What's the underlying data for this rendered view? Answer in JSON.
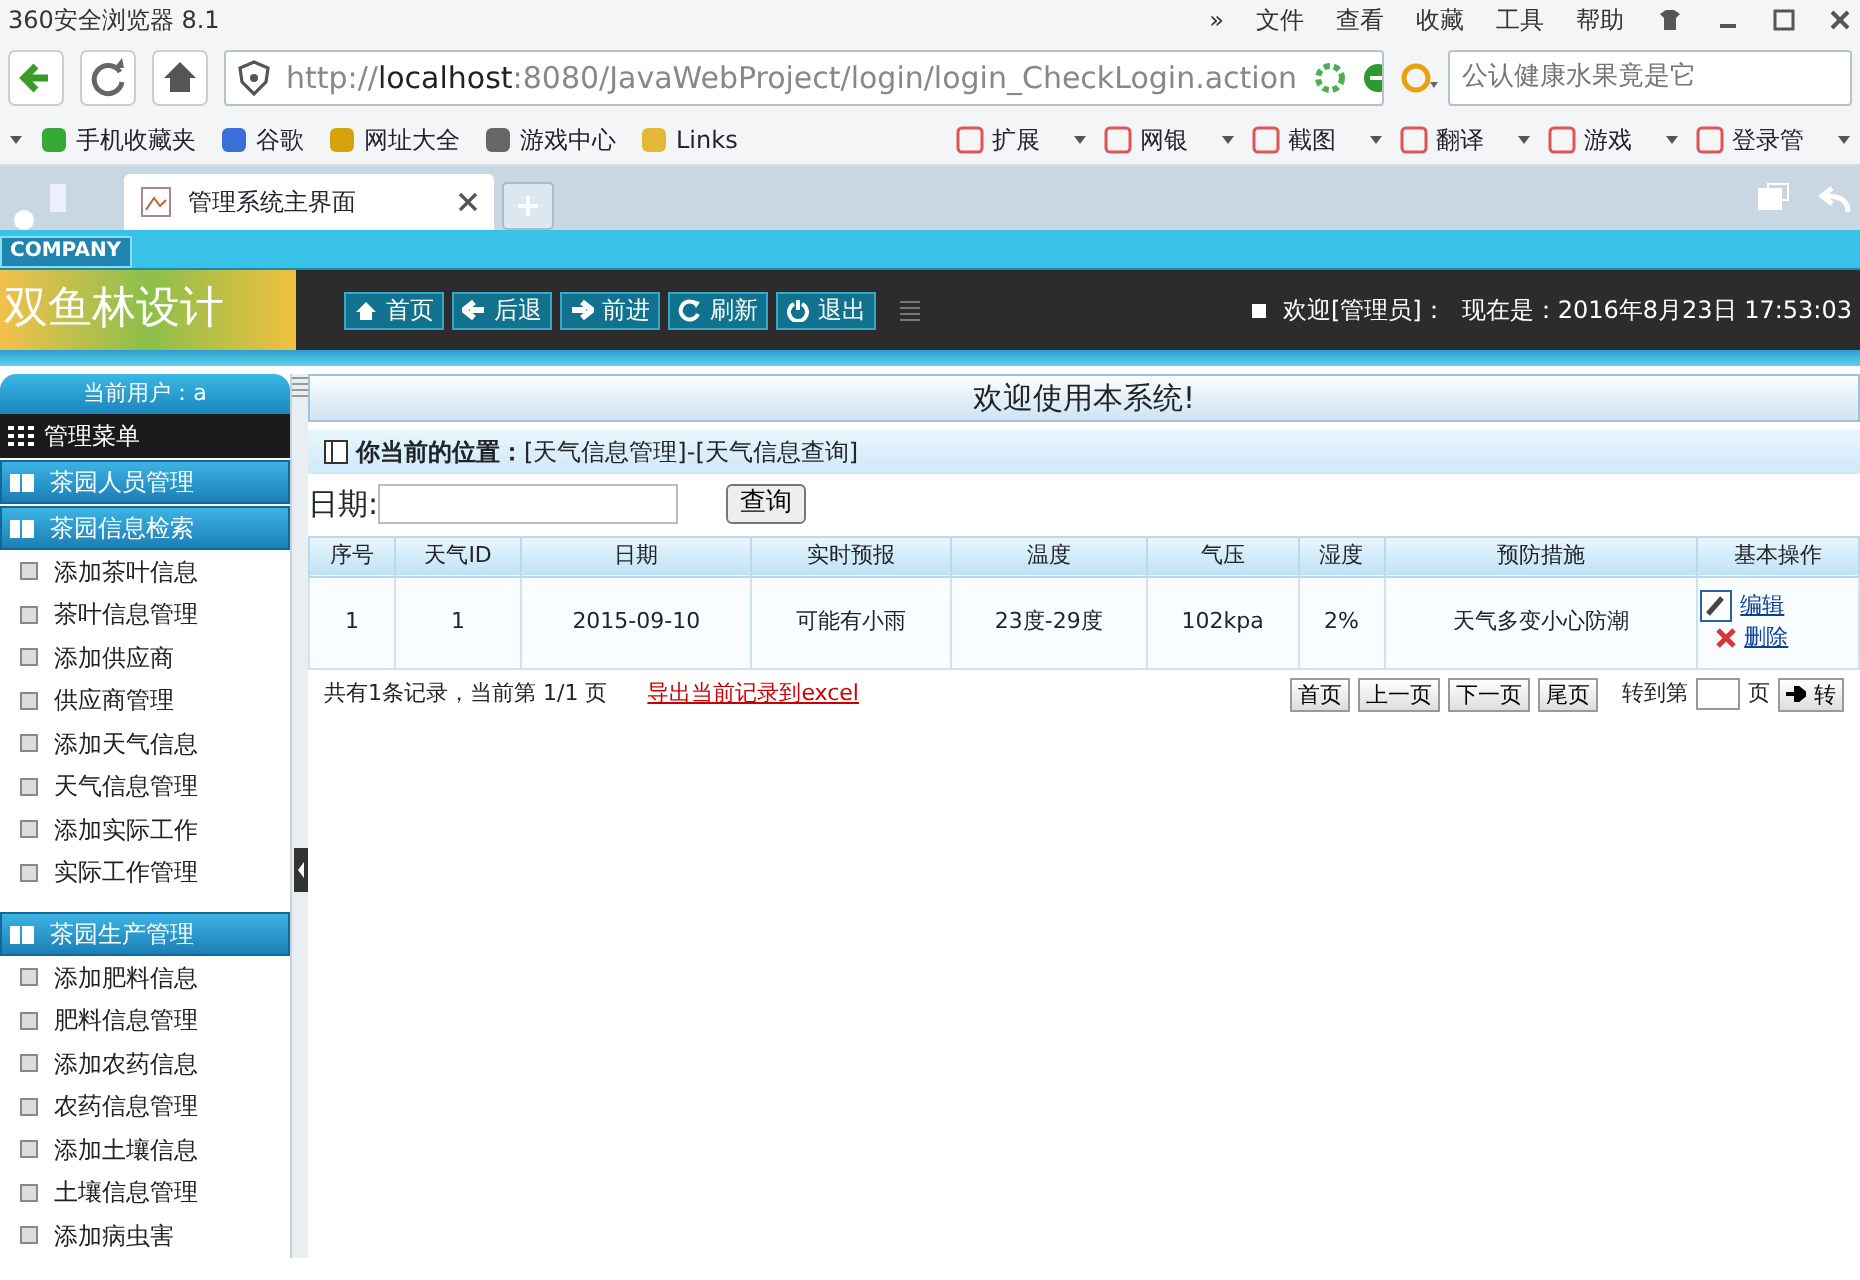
{
  "browser": {
    "title": "360安全浏览器 8.1",
    "menu": [
      "»",
      "文件",
      "查看",
      "收藏",
      "工具",
      "帮助"
    ],
    "url": {
      "scheme": "http://",
      "host": "localhost",
      "path": ":8080/JavaWebProject/login/login_CheckLogin.action"
    },
    "search": {
      "placeholder": "公认健康水果竟是它"
    },
    "bookmarks": [
      "手机收藏夹",
      "谷歌",
      "网址大全",
      "游戏中心",
      "Links"
    ],
    "tools": [
      "扩展",
      "网银",
      "截图",
      "翻译",
      "游戏",
      "登录管"
    ],
    "tabs": [
      {
        "label": "管理系统主界面",
        "selected": true
      }
    ]
  },
  "app": {
    "company": "COMPANY",
    "logo": "双鱼林设计",
    "nav": [
      "首页",
      "后退",
      "前进",
      "刷新",
      "退出"
    ],
    "welcome": "欢迎[管理员]：",
    "clock": "现在是：2016年8月23日 17:53:03"
  },
  "sidebar": {
    "user": "当前用户：a",
    "menu_title": "管理菜单",
    "sections": [
      {
        "title": "茶园人员管理"
      },
      {
        "title": "茶园信息检索",
        "items": [
          "添加茶叶信息",
          "茶叶信息管理",
          "添加供应商",
          "供应商管理",
          "添加天气信息",
          "天气信息管理",
          "添加实际工作",
          "实际工作管理"
        ]
      },
      {
        "title": "茶园生产管理",
        "items": [
          "添加肥料信息",
          "肥料信息管理",
          "添加农药信息",
          "农药信息管理",
          "添加土壤信息",
          "土壤信息管理",
          "添加病虫害"
        ]
      }
    ]
  },
  "main": {
    "title": "欢迎使用本系统!",
    "location_label": "你当前的位置：",
    "location": "[天气信息管理]-[天气信息查询]",
    "filter_label": "日期:",
    "search_button": "查询",
    "table": {
      "columns": [
        "序号",
        "天气ID",
        "日期",
        "实时预报",
        "温度",
        "气压",
        "湿度",
        "预防措施",
        "基本操作"
      ],
      "rows": [
        {
          "cells": [
            "1",
            "1",
            "2015-09-10",
            "可能有小雨",
            "23度-29度",
            "102kpa",
            "2%",
            "天气多变小心防潮"
          ],
          "actions": [
            "编辑",
            "删除"
          ]
        }
      ]
    },
    "pager": {
      "summary": "共有1条记录，当前第 1/1 页",
      "export": "导出当前记录到excel",
      "buttons": [
        "首页",
        "上一页",
        "下一页",
        "尾页"
      ],
      "goto_label": "转到第",
      "page_unit": "页",
      "go_button": "转"
    }
  }
}
